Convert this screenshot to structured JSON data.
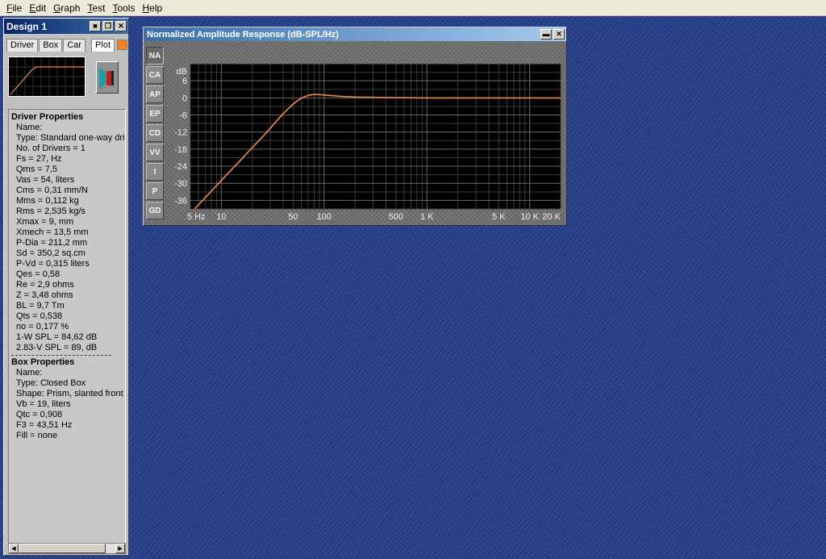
{
  "menu": [
    {
      "ul": "F",
      "rest": "ile"
    },
    {
      "ul": "E",
      "rest": "dit"
    },
    {
      "ul": "G",
      "rest": "raph"
    },
    {
      "ul": "T",
      "rest": "est"
    },
    {
      "ul": "T",
      "rest": "ools"
    },
    {
      "ul": "H",
      "rest": "elp"
    }
  ],
  "design": {
    "title": "Design 1",
    "tabs": [
      "Driver",
      "Box",
      "Car"
    ],
    "plot_label": "Plot",
    "driver_heading": "Driver Properties",
    "driver_props": [
      "Name:",
      "Type: Standard one-way driv",
      "No. of Drivers = 1",
      "Fs =  27, Hz",
      "Qms =  7,5",
      "Vas =  54, liters",
      "Cms =  0,31 mm/N",
      "Mms =  0,112 kg",
      "Rms =  2,535 kg/s",
      "Xmax =  9, mm",
      "Xmech =  13,5 mm",
      "P-Dia =  211,2 mm",
      "Sd =  350,2 sq.cm",
      "P-Vd =  0,315 liters",
      "Qes =  0,58",
      "Re =  2,9 ohms",
      "Z =  3,48 ohms",
      "BL =  9,7 Tm",
      "Qts =  0,538",
      "no =  0,177 %",
      "1-W SPL =  84,62 dB",
      "2.83-V SPL =  89, dB"
    ],
    "box_heading": "Box Properties",
    "box_props": [
      "Name:",
      "Type: Closed Box",
      "Shape: Prism, slanted front",
      "Vb =  19, liters",
      "Qtc =  0,908",
      "F3 =  43,51 Hz",
      "Fill = none"
    ]
  },
  "graph": {
    "title": "Normalized Amplitude Response (dB-SPL/Hz)",
    "side_tabs": [
      "NA",
      "CA",
      "AP",
      "EP",
      "CD",
      "VV",
      "I",
      "P",
      "GD"
    ],
    "active_tab": "NA"
  },
  "chart_data": {
    "type": "line",
    "title": "Normalized Amplitude Response (dB-SPL/Hz)",
    "ylabel": "dB",
    "xlabel": "",
    "xscale": "log",
    "xlim": [
      5,
      20000
    ],
    "ylim": [
      -39,
      12
    ],
    "yticks": [
      6,
      0,
      -6,
      -12,
      -18,
      -24,
      -30,
      -36
    ],
    "ytick_labels": [
      "6",
      "0",
      "-6",
      "-12",
      "-18",
      "-24",
      "-30",
      "-36"
    ],
    "xticks": [
      5,
      10,
      50,
      100,
      500,
      1000,
      5000,
      10000,
      20000
    ],
    "xtick_labels": [
      "5 Hz",
      "10",
      "50",
      "100",
      "500",
      "1 K",
      "5 K",
      "10 K",
      "20 K"
    ],
    "grid": true,
    "line_color": "#f08a4b",
    "series": [
      {
        "x": [
          5.5,
          10,
          15,
          20,
          25,
          30,
          35,
          40,
          45,
          50,
          55,
          60,
          70,
          80,
          90,
          100,
          150,
          200,
          500,
          1000,
          5000,
          10000,
          20000
        ],
        "y": [
          -39,
          -29,
          -22.3,
          -17.5,
          -13.8,
          -10.6,
          -7.9,
          -5.6,
          -3.7,
          -2.2,
          -1.0,
          -0.1,
          0.9,
          1.2,
          1.15,
          1.0,
          0.5,
          0.3,
          0.1,
          0.0,
          0.0,
          0.0,
          0.0
        ]
      }
    ]
  }
}
